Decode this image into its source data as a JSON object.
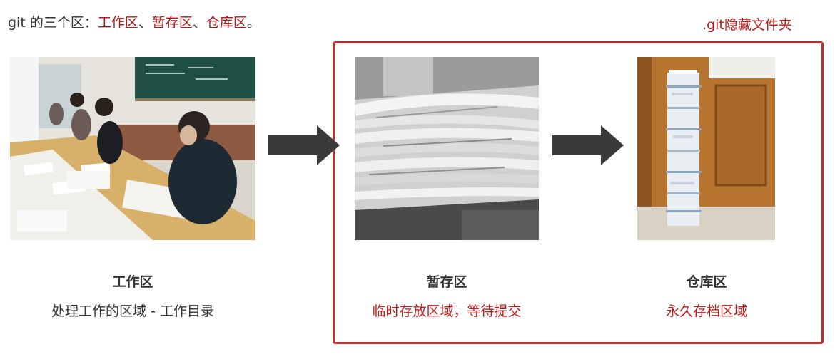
{
  "heading": {
    "prefix": "git 的三个区：",
    "zone1": "工作区",
    "sep1": "、",
    "zone2": "暂存区",
    "sep2": "、",
    "zone3": "仓库区",
    "suffix": "。"
  },
  "git_folder_label": ".git隐藏文件夹",
  "zones": [
    {
      "title": "工作区",
      "description": "处理工作的区域 - 工作目录"
    },
    {
      "title": "暂存区",
      "description": "临时存放区域，等待提交"
    },
    {
      "title": "仓库区",
      "description": "永久存档区域"
    }
  ],
  "colors": {
    "accent_red": "#c21a1a",
    "box_border": "#b83232",
    "arrow": "#3a3a3a",
    "text": "#333333"
  }
}
